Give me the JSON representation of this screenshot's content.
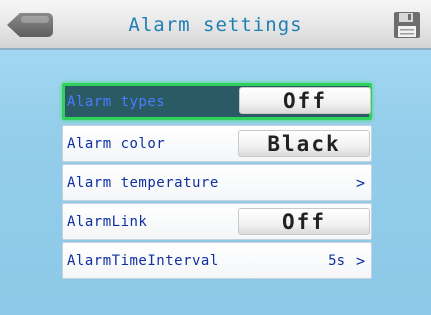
{
  "header": {
    "title": "Alarm settings",
    "back_icon": "back-arrow-icon",
    "save_icon": "floppy-disk-icon"
  },
  "menu": {
    "alarm_types": {
      "label": "Alarm types",
      "value": "Off",
      "selected": true
    },
    "alarm_color": {
      "label": "Alarm color",
      "value": "Black"
    },
    "alarm_temperature": {
      "label": "Alarm temperature",
      "chevron": ">"
    },
    "alarm_link": {
      "label": "AlarmLink",
      "value": "Off"
    },
    "alarm_time_interval": {
      "label": "AlarmTimeInterval",
      "value": "5s",
      "chevron": ">"
    }
  },
  "colors": {
    "background": "#93cdea",
    "title": "#1f7fb3",
    "label": "#1030a0",
    "selected_border": "#2fd15a",
    "selected_bg": "#2a5a63"
  }
}
